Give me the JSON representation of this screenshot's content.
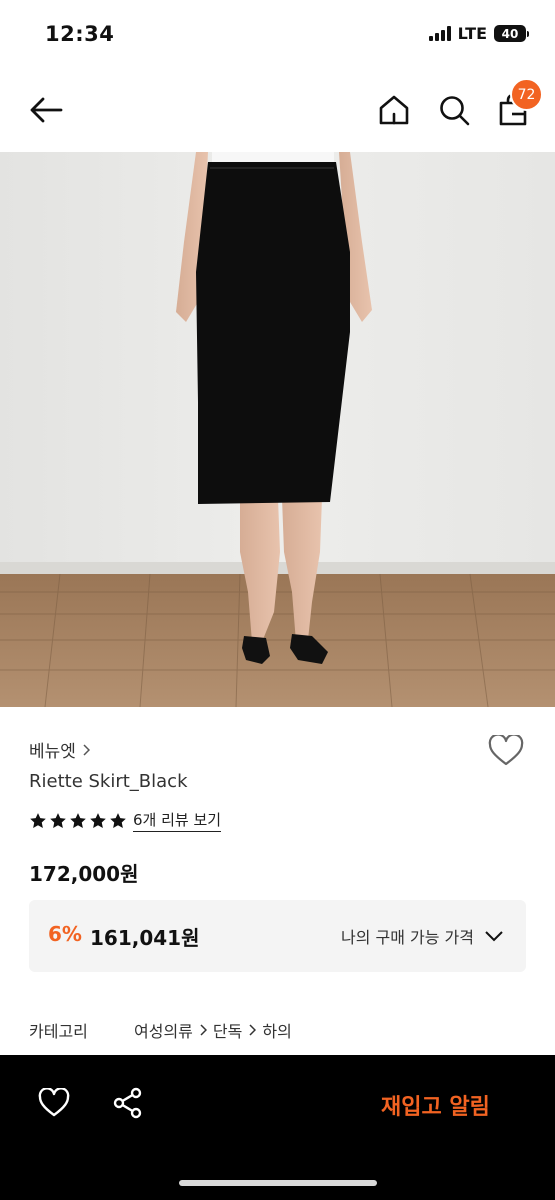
{
  "status": {
    "time": "12:34",
    "network": "LTE",
    "battery": "40"
  },
  "nav": {
    "cart_count": "72"
  },
  "colors": {
    "accent": "#f26322",
    "bottom_bar": "#000000",
    "price_box_bg": "#f4f4f4"
  },
  "icons": {
    "back": "arrow-left-icon",
    "home": "home-icon",
    "search": "search-icon",
    "cart": "shopping-bag-icon",
    "wishlist": "heart-outline-icon",
    "share": "share-icon"
  },
  "product": {
    "brand": "베뉴엣",
    "name": "Riette Skirt_Black",
    "rating": 5,
    "review_link": "6개 리뷰 보기",
    "price": "172,000원",
    "discount_percent": "6%",
    "discount_price": "161,041원",
    "my_price_label": "나의 구매 가능 가격",
    "category_label": "카테고리",
    "categories": [
      "여성의류",
      "단독",
      "하의"
    ]
  },
  "bottom": {
    "restock_label": "재입고 알림"
  }
}
